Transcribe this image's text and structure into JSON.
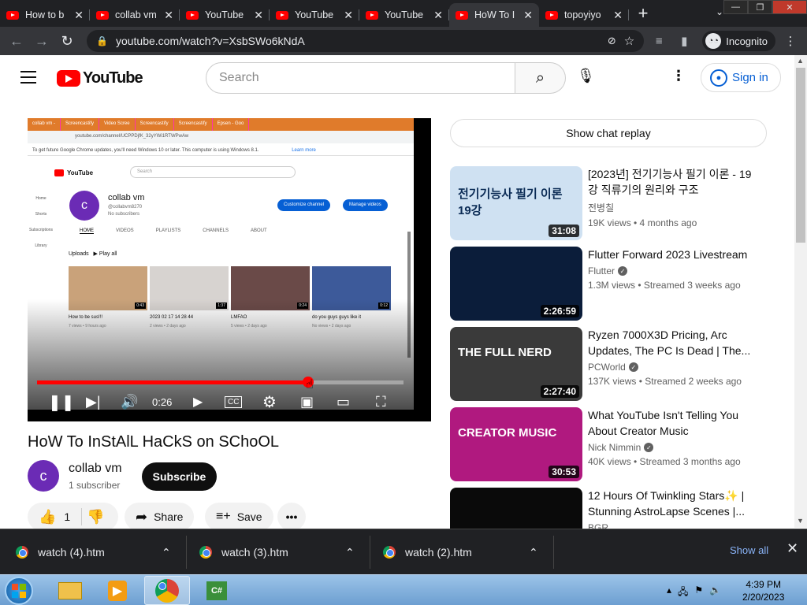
{
  "browser": {
    "tabs": [
      {
        "label": "How to b",
        "active": false
      },
      {
        "label": "collab vm",
        "active": false
      },
      {
        "label": "YouTube",
        "active": false
      },
      {
        "label": "YouTube",
        "active": false
      },
      {
        "label": "YouTube",
        "active": false
      },
      {
        "label": "HoW To I",
        "active": true
      },
      {
        "label": "topoyiyo",
        "active": false
      }
    ],
    "url": "youtube.com/watch?v=XsbSWo6kNdA",
    "incognito_label": "Incognito"
  },
  "youtube": {
    "logo_text": "YouTube",
    "search_placeholder": "Search",
    "sign_in": "Sign in"
  },
  "player": {
    "time": "0:26",
    "progress_fraction": 0.74,
    "embedded": {
      "tabs": [
        "collab vm -",
        "Screencastify",
        "Video Scree",
        "Screencastify",
        "Screencastify",
        "Epsen - Goo"
      ],
      "address": "youtube.com/channel/UCPPDjfK_32yYWi1RTWPwAw",
      "notice": "To get future Google Chrome updates, you'll need Windows 10 or later. This computer is using Windows 8.1.",
      "learn_more": "Learn more",
      "logo": "YouTube",
      "search": "Search",
      "side_items": [
        "Home",
        "Shorts",
        "Subscriptions",
        "Library"
      ],
      "channel_initial": "c",
      "channel_name": "collab vm",
      "channel_handle": "@collabvm8270",
      "channel_subs": "No subscribers",
      "customize": "Customize channel",
      "manage": "Manage videos",
      "nav": [
        "HOME",
        "VIDEOS",
        "PLAYLISTS",
        "CHANNELS",
        "ABOUT"
      ],
      "uploads": "Uploads",
      "play_all": "Play all",
      "videos": [
        {
          "title": "How to be sus!!!",
          "meta": "7 views • 9 hours ago",
          "dur": "0:43",
          "color": "#c9a27a"
        },
        {
          "title": "2023 02 17 14 28 44",
          "meta": "2 views • 2 days ago",
          "dur": "1:37",
          "color": "#d7d3d0"
        },
        {
          "title": "LMFAO",
          "meta": "5 views • 2 days ago",
          "dur": "0:24",
          "color": "#6a4a48"
        },
        {
          "title": "do you guys guys like it",
          "meta": "No views • 2 days ago",
          "dur": "0:12",
          "color": "#3d5a9a"
        }
      ]
    }
  },
  "video": {
    "title": "HoW To InStAlL HaCkS on SChoOL",
    "channel_initial": "c",
    "channel_name": "collab vm",
    "subscribers": "1 subscriber",
    "subscribe": "Subscribe",
    "likes": "1",
    "share": "Share",
    "save": "Save"
  },
  "sidebar": {
    "chat_replay": "Show chat replay",
    "recommendations": [
      {
        "title": "[2023년] 전기기능사 필기 이론 - 19강 직류기의 원리와 구조",
        "channel": "전병칠",
        "verified": false,
        "meta": "19K views  • 4 months ago",
        "duration": "31:08",
        "thumb_text": "전기기능사 필기 이론 19강",
        "thumb_color": "#cfe1f2"
      },
      {
        "title": "Flutter Forward 2023 Livestream",
        "channel": "Flutter",
        "verified": true,
        "meta": "1.3M views  • Streamed 3 weeks ago",
        "duration": "2:26:59",
        "thumb_text": "",
        "thumb_color": "#0b1d3a"
      },
      {
        "title": "Ryzen 7000X3D Pricing, Arc Updates, The PC Is Dead | The...",
        "channel": "PCWorld",
        "verified": true,
        "meta": "137K views  • Streamed 2 weeks ago",
        "duration": "2:27:40",
        "thumb_text": "THE FULL NERD",
        "thumb_color": "#3a3a3a"
      },
      {
        "title": "What YouTube Isn't Telling You About Creator Music",
        "channel": "Nick Nimmin",
        "verified": true,
        "meta": "40K views  • Streamed 3 months ago",
        "duration": "30:53",
        "thumb_text": "CREATOR MUSIC",
        "thumb_color": "#b0197f"
      },
      {
        "title": "12 Hours Of Twinkling Stars✨ | Stunning AstroLapse Scenes |...",
        "channel": "BGR",
        "verified": false,
        "meta": "",
        "duration": "",
        "thumb_text": "",
        "thumb_color": "#0a0a0a"
      }
    ]
  },
  "downloads": {
    "items": [
      "watch (4).htm",
      "watch (3).htm",
      "watch (2).htm"
    ],
    "show_all": "Show all"
  },
  "taskbar": {
    "time": "4:39 PM",
    "date": "2/20/2023"
  }
}
